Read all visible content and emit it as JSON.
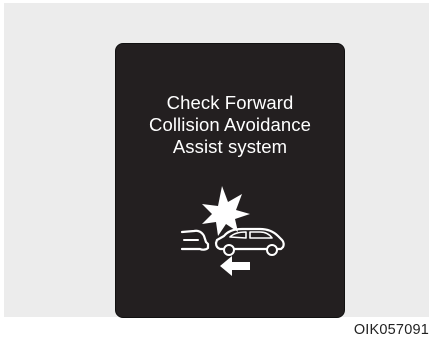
{
  "warning": {
    "line1": "Check Forward",
    "line2": "Collision Avoidance",
    "line3": "Assist system",
    "icon": "forward-collision-warning-icon"
  },
  "caption": "OIK057091",
  "colors": {
    "background": "#ececec",
    "display": "#231f20",
    "foreground": "#ffffff"
  }
}
